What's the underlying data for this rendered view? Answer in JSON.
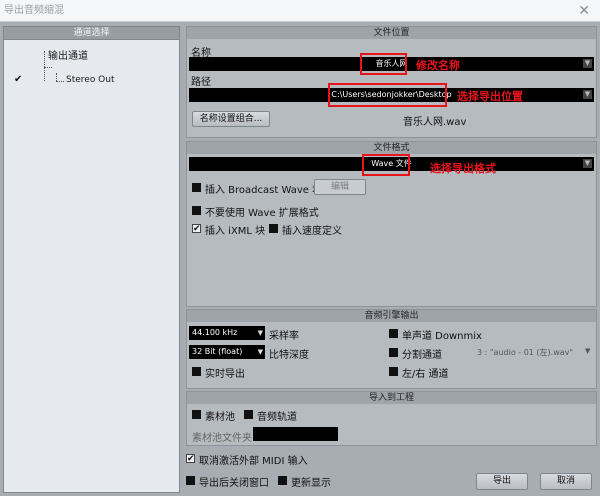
{
  "window": {
    "title": "导出音频缩混",
    "close_glyph": "✕"
  },
  "channel_panel": {
    "header": "通道选择",
    "root_label": "输出通道",
    "child_label": "Stereo Out",
    "child_checked": true,
    "check_glyph": "✔"
  },
  "file_location": {
    "header": "文件位置",
    "name_label": "名称",
    "name_value": "音乐人网",
    "name_annotation": "修改名称",
    "path_label": "路径",
    "path_value": "C:\\Users\\sedonjokker\\Desktop",
    "path_annotation": "选择导出位置",
    "naming_button": "名称设置组合...",
    "filename_preview": "音乐人网.wav",
    "arrow_glyph": "▼"
  },
  "file_format": {
    "header": "文件格式",
    "format_value": "Wave 文件",
    "format_annotation": "选择导出格式",
    "broadcast_label": "插入 Broadcast Wave 块",
    "broadcast_checked": false,
    "edit_button": "编辑",
    "no_ext_label": "不要使用 Wave 扩展格式",
    "no_ext_checked": false,
    "ixml_label": "插入 iXML 块",
    "ixml_checked": true,
    "tempo_label": "插入速度定义",
    "tempo_checked": false
  },
  "engine_output": {
    "header": "音频引擎输出",
    "sample_rate_value": "44.100 kHz",
    "sample_rate_label": "采样率",
    "bit_depth_value": "32 Bit (float)",
    "bit_depth_label": "比特深度",
    "realtime_label": "实时导出",
    "realtime_checked": false,
    "mono_downmix_label": "单声道 Downmix",
    "mono_downmix_checked": false,
    "split_channels_label": "分割通道",
    "split_channels_checked": false,
    "split_preview": "3 : \"audio - 01 (左).wav\"",
    "lr_channels_label": "左/右 通道",
    "lr_channels_checked": false
  },
  "import_project": {
    "header": "导入到工程",
    "pool_label": "素材池",
    "pool_checked": false,
    "audio_track_label": "音频轨道",
    "audio_track_checked": false,
    "pool_folder_label": "素材池文件夹",
    "pool_folder_value": ""
  },
  "footer": {
    "deactivate_midi_label": "取消激活外部 MIDI 输入",
    "deactivate_midi_checked": true,
    "close_after_label": "导出后关闭窗口",
    "close_after_checked": false,
    "update_display_label": "更新显示",
    "update_display_checked": false,
    "export_button": "导出",
    "cancel_button": "取消"
  },
  "colors": {
    "annotation_red": "#e8141b",
    "panel_bg": "#b6bbc0",
    "field_bg": "#000000"
  }
}
